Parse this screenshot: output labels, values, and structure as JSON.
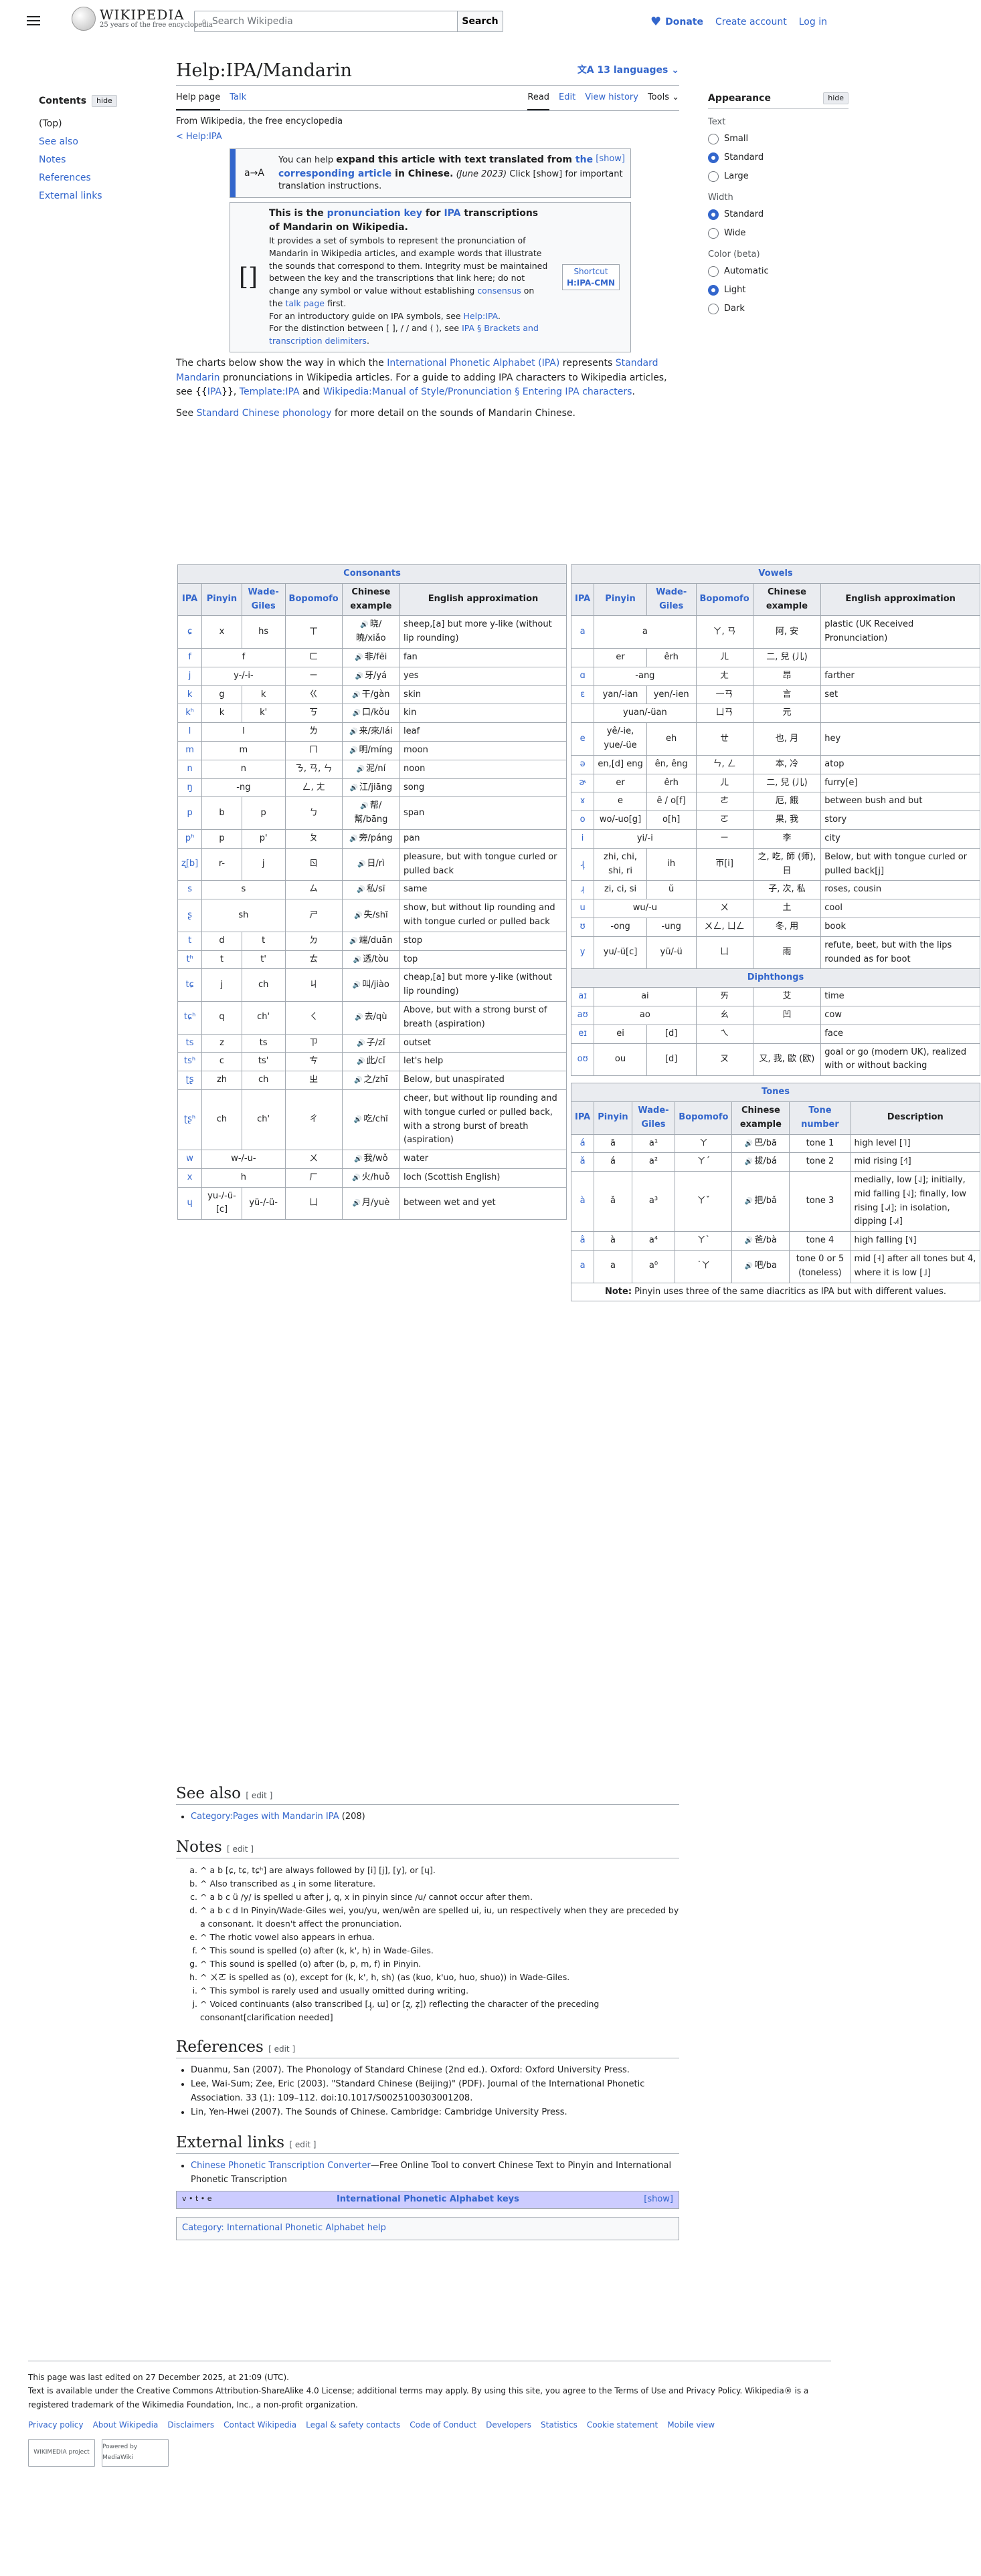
{
  "header": {
    "wordmark": "WIKIPEDIA",
    "tagline": "25 years of the free encyclopedia",
    "search_placeholder": "Search Wikipedia",
    "search_button": "Search",
    "donate": "Donate",
    "create_account": "Create account",
    "log_in": "Log in"
  },
  "toc": {
    "title": "Contents",
    "hide": "hide",
    "items": [
      "(Top)",
      "See also",
      "Notes",
      "References",
      "External links"
    ]
  },
  "page": {
    "title": "Help:IPA/Mandarin",
    "languages": "13 languages",
    "tab_help": "Help page",
    "tab_talk": "Talk",
    "read": "Read",
    "edit": "Edit",
    "view_history": "View history",
    "tools": "Tools",
    "from": "From Wikipedia, the free encyclopedia",
    "back": "< Help:IPA"
  },
  "expand_box": {
    "icon": "a→A",
    "lead": "You can help ",
    "bold1": "expand this article with text translated from ",
    "link": "the corresponding article",
    "bold2": " in Chinese.",
    "date": " (June 2023)",
    "rest": " Click [show] for important translation instructions.",
    "show": "[show]"
  },
  "pron_box": {
    "icon": "[]",
    "t1": "This is the ",
    "link1": "pronunciation key",
    "t2": " for ",
    "link2": "IPA",
    "t3": " transcriptions of Mandarin on Wikipedia.",
    "p1": "It provides a set of symbols to represent the pronunciation of Mandarin in Wikipedia articles, and example words that illustrate the sounds that correspond to them. Integrity must be maintained between the key and the transcriptions that link here; do not change any symbol or value without establishing ",
    "consensus": "consensus",
    "p1b": " on the ",
    "talk": "talk page",
    "p1c": " first.",
    "p2": "For an introductory guide on IPA symbols, see ",
    "help_ipa": "Help:IPA",
    "p3": "For the distinction between [ ], / / and ⟨ ⟩, see ",
    "brackets": "IPA § Brackets and transcription delimiters",
    "shortcut": "Shortcut",
    "shortcut_val": "H:IPA-CMN"
  },
  "intro": {
    "a": "The charts below show the way in which the ",
    "ipa": "International Phonetic Alphabet (IPA)",
    "b": " represents ",
    "sm": "Standard Mandarin",
    "c": " pronunciations in Wikipedia articles. For a guide to adding IPA characters to Wikipedia articles, see {{",
    "ipatpl": "IPA",
    "d": "}}, ",
    "tplipa": "Template:IPA",
    "e": " and ",
    "mos": "Wikipedia:Manual of Style/Pronunciation § Entering IPA characters",
    "f": ".",
    "see_a": "See ",
    "scp": "Standard Chinese phonology",
    "see_b": " for more detail on the sounds of Mandarin Chinese."
  },
  "consonants": {
    "title": "Consonants",
    "headers": [
      "IPA",
      "Pinyin",
      "Wade-Giles",
      "Bopomofo",
      "Chinese example",
      "English approximation"
    ],
    "rows": [
      [
        "ɕ",
        "x",
        "hs",
        "ㄒ",
        "晓/曉/xiǎo",
        "sheep,[a] but more y-like (without lip rounding)"
      ],
      [
        "f",
        "f",
        "",
        "ㄈ",
        "非/fēi",
        "fan"
      ],
      [
        "j",
        "y-/-i-",
        "",
        "ㄧ",
        "牙/yá",
        "yes"
      ],
      [
        "k",
        "g",
        "k",
        "ㄍ",
        "干/gàn",
        "skin"
      ],
      [
        "kʰ",
        "k",
        "k'",
        "ㄎ",
        "口/kǒu",
        "kin"
      ],
      [
        "l",
        "l",
        "",
        "ㄌ",
        "来/來/lái",
        "leaf"
      ],
      [
        "m",
        "m",
        "",
        "ㄇ",
        "明/míng",
        "moon"
      ],
      [
        "n",
        "n",
        "",
        "ㄋ, ㄢ, ㄣ",
        "泥/ní",
        "noon"
      ],
      [
        "ŋ",
        "-ng",
        "",
        "ㄥ, ㄤ",
        "江/jiāng",
        "song"
      ],
      [
        "p",
        "b",
        "p",
        "ㄅ",
        "帮/幫/bāng",
        "span"
      ],
      [
        "pʰ",
        "p",
        "p'",
        "ㄆ",
        "旁/páng",
        "pan"
      ],
      [
        "ʐ[b]",
        "r-",
        "j",
        "ㄖ",
        "日/rì",
        "pleasure, but with tongue curled or pulled back"
      ],
      [
        "s",
        "s",
        "",
        "ㄙ",
        "私/sī",
        "same"
      ],
      [
        "ʂ",
        "sh",
        "",
        "ㄕ",
        "失/shī",
        "show, but without lip rounding and with tongue curled or pulled back"
      ],
      [
        "t",
        "d",
        "t",
        "ㄉ",
        "端/duān",
        "stop"
      ],
      [
        "tʰ",
        "t",
        "t'",
        "ㄊ",
        "透/tòu",
        "top"
      ],
      [
        "tɕ",
        "j",
        "ch",
        "ㄐ",
        "叫/jiào",
        "cheap,[a] but more y-like (without lip rounding)"
      ],
      [
        "tɕʰ",
        "q",
        "ch'",
        "ㄑ",
        "去/qù",
        "Above, but with a strong burst of breath (aspiration)"
      ],
      [
        "ts",
        "z",
        "ts",
        "ㄗ",
        "子/zǐ",
        "outset"
      ],
      [
        "tsʰ",
        "c",
        "ts'",
        "ㄘ",
        "此/cǐ",
        "let's help"
      ],
      [
        "ʈʂ",
        "zh",
        "ch",
        "ㄓ",
        "之/zhī",
        "Below, but unaspirated"
      ],
      [
        "ʈʂʰ",
        "ch",
        "ch'",
        "ㄔ",
        "吃/chī",
        "cheer, but without lip rounding and with tongue curled or pulled back, with a strong burst of breath (aspiration)"
      ],
      [
        "w",
        "w-/-u-",
        "",
        "ㄨ",
        "我/wǒ",
        "water"
      ],
      [
        "x",
        "h",
        "",
        "ㄏ",
        "火/huǒ",
        "loch (Scottish English)"
      ],
      [
        "ɥ",
        "yu-/-ü-[c]",
        "yü-/-ü-",
        "ㄩ",
        "月/yuè",
        "between wet and yet"
      ]
    ]
  },
  "vowels": {
    "title": "Vowels",
    "headers": [
      "IPA",
      "Pinyin",
      "Wade-Giles",
      "Bopomofo",
      "Chinese example",
      "English approximation"
    ],
    "rows": [
      [
        "a",
        "a",
        "",
        "ㄚ, ㄢ",
        "阿, 安",
        "plastic (UK Received Pronunciation)"
      ],
      [
        "",
        "er",
        "êrh",
        "ㄦ",
        "二, 兒 (儿)",
        ""
      ],
      [
        "ɑ",
        "-ang",
        "",
        "ㄤ",
        "昂",
        "farther"
      ],
      [
        "ɛ",
        "yan/-ian",
        "yen/-ien",
        "一ㄢ",
        "言",
        "set"
      ],
      [
        "",
        "yuan/-üan",
        "",
        "ㄩㄢ",
        "元",
        ""
      ],
      [
        "e",
        "yê/-ie, yue/-üe",
        "eh",
        "ㄝ",
        "也, 月",
        "hey"
      ],
      [
        "ə",
        "en,[d] eng",
        "ên, êng",
        "ㄣ, ㄥ",
        "本, 冷",
        "atop"
      ],
      [
        "ɚ",
        "er",
        "êrh",
        "ㄦ",
        "二, 兒 (儿)",
        "furry[e]"
      ],
      [
        "ɤ",
        "e",
        "ê / o[f]",
        "ㄜ",
        "厄, 餓",
        "between bush and but"
      ],
      [
        "o",
        "wo/-uo[g]",
        "o[h]",
        "ㄛ",
        "果, 我",
        "story"
      ],
      [
        "i",
        "yi/-i",
        "",
        "ㄧ",
        "李",
        "city"
      ],
      [
        "ɻ̩",
        "zhi, chi, shi, ri",
        "ih",
        "ㄭ[i]",
        "之, 吃, 師 (师), 日",
        "Below, but with tongue curled or pulled back[j]"
      ],
      [
        "ɹ̩",
        "zi, ci, si",
        "ŭ",
        "",
        "子, 次, 私",
        "roses, cousin"
      ],
      [
        "u",
        "wu/-u",
        "",
        "ㄨ",
        "土",
        "cool"
      ],
      [
        "ʊ",
        "-ong",
        "-ung",
        "ㄨㄥ, ㄩㄥ",
        "冬, 用",
        "book"
      ],
      [
        "y",
        "yu/-ü[c]",
        "yü/-ü",
        "ㄩ",
        "雨",
        "refute, beet, but with the lips rounded as for boot"
      ]
    ]
  },
  "diphthongs": {
    "title": "Diphthongs",
    "rows": [
      [
        "aɪ",
        "ai",
        "",
        "ㄞ",
        "艾",
        "time"
      ],
      [
        "aʊ",
        "ao",
        "",
        "ㄠ",
        "凹",
        "cow"
      ],
      [
        "eɪ",
        "ei",
        "[d]",
        "ㄟ",
        "",
        "face"
      ],
      [
        "oʊ",
        "ou",
        "[d]",
        "ㄡ",
        "又, 我, 歐 (欧)",
        "goal or go (modern UK), realized with or without backing"
      ]
    ]
  },
  "tones": {
    "title": "Tones",
    "headers": [
      "IPA",
      "Pinyin",
      "Wade-Giles",
      "Bopomofo",
      "Chinese example",
      "Tone number",
      "Description"
    ],
    "rows": [
      [
        "á",
        "ā",
        "a¹",
        "ㄚ",
        "巴/bā",
        "tone 1",
        "high level [˥]"
      ],
      [
        "ǎ",
        "á",
        "a²",
        "ㄚˊ",
        "拔/bá",
        "tone 2",
        "mid rising [˧˥]"
      ],
      [
        "à",
        "ǎ",
        "a³",
        "ㄚˇ",
        "把/bǎ",
        "tone 3",
        "medially, low [˨˩]; initially, mid falling [˧˩]; finally, low rising [˨˩˦]; in isolation, dipping [˨˩˦]"
      ],
      [
        "â",
        "à",
        "a⁴",
        "ㄚˋ",
        "爸/bà",
        "tone 4",
        "high falling [˥˩]"
      ],
      [
        "a",
        "a",
        "a⁰",
        "˙ㄚ",
        "吧/ba",
        "tone 0 or 5 (toneless)",
        "mid [˧] after all tones but 4, where it is low [˩]"
      ]
    ],
    "note_b": "Note:",
    "note": " Pinyin uses three of the same diacritics as IPA but with different values."
  },
  "see_also": {
    "title": "See also",
    "edit": "[ edit ]",
    "item": "Category:Pages with Mandarin IPA",
    "count": " (208)"
  },
  "notes": {
    "title": "Notes",
    "edit": "[ edit ]",
    "items": [
      "^ a b [ɕ, tɕ, tɕʰ] are always followed by [i] [j], [y], or [ɥ].",
      "^ Also transcribed as ɻ in some literature.",
      "^ a b c ü /y/ is spelled u after j, q, x in pinyin since /u/ cannot occur after them.",
      "^ a b c d In Pinyin/Wade-Giles wei, you/yu, wen/wên are spelled ui, iu, un respectively when they are preceded by a consonant. It doesn't affect the pronunciation.",
      "^ The rhotic vowel also appears in erhua.",
      "^ This sound is spelled (o) after (k, k', h) in Wade-Giles.",
      "^ This sound is spelled (o) after (b, p, m, f) in Pinyin.",
      "^ ㄨㄛ is spelled as (o), except for (k, k', h, sh) (as (kuo, k'uo, huo, shuo)) in Wade-Giles.",
      "^ This symbol is rarely used and usually omitted during writing.",
      "^ Voiced continuants (also transcribed [ɻ̩, ɯ] or [ʐ̩, z̩]) reflecting the character of the preceding consonant[clarification needed]"
    ]
  },
  "refs": {
    "title": "References",
    "edit": "[ edit ]",
    "items": [
      "Duanmu, San (2007). The Phonology of Standard Chinese (2nd ed.). Oxford: Oxford University Press.",
      "Lee, Wai-Sum; Zee, Eric (2003). \"Standard Chinese (Beijing)\" (PDF). Journal of the International Phonetic Association. 33 (1): 109–112. doi:10.1017/S0025100303001208.",
      "Lin, Yen-Hwei (2007). The Sounds of Chinese. Cambridge: Cambridge University Press."
    ]
  },
  "ext": {
    "title": "External links",
    "edit": "[ edit ]",
    "link": "Chinese Phonetic Transcription Converter",
    "rest": "—Free Online Tool to convert Chinese Text to Pinyin and International Phonetic Transcription"
  },
  "navbox": {
    "vte": "v • t • e",
    "title": "International Phonetic Alphabet keys",
    "show": "[show]"
  },
  "category": {
    "label": "Category:",
    "value": "International Phonetic Alphabet help"
  },
  "appearance": {
    "title": "Appearance",
    "hide": "hide",
    "text": "Text",
    "text_opts": [
      "Small",
      "Standard",
      "Large"
    ],
    "width": "Width",
    "width_opts": [
      "Standard",
      "Wide"
    ],
    "color": "Color (beta)",
    "color_opts": [
      "Automatic",
      "Light",
      "Dark"
    ]
  },
  "footer": {
    "edited": "This page was last edited on 27 December 2025, at 21:09 (UTC).",
    "license": "Text is available under the Creative Commons Attribution-ShareAlike 4.0 License; additional terms may apply. By using this site, you agree to the Terms of Use and Privacy Policy. Wikipedia® is a registered trademark of the Wikimedia Foundation, Inc., a non-profit organization.",
    "links": [
      "Privacy policy",
      "About Wikipedia",
      "Disclaimers",
      "Contact Wikipedia",
      "Legal & safety contacts",
      "Code of Conduct",
      "Developers",
      "Statistics",
      "Cookie statement",
      "Mobile view"
    ],
    "badge1": "WIKIMEDIA project",
    "badge2": "Powered by MediaWiki"
  }
}
